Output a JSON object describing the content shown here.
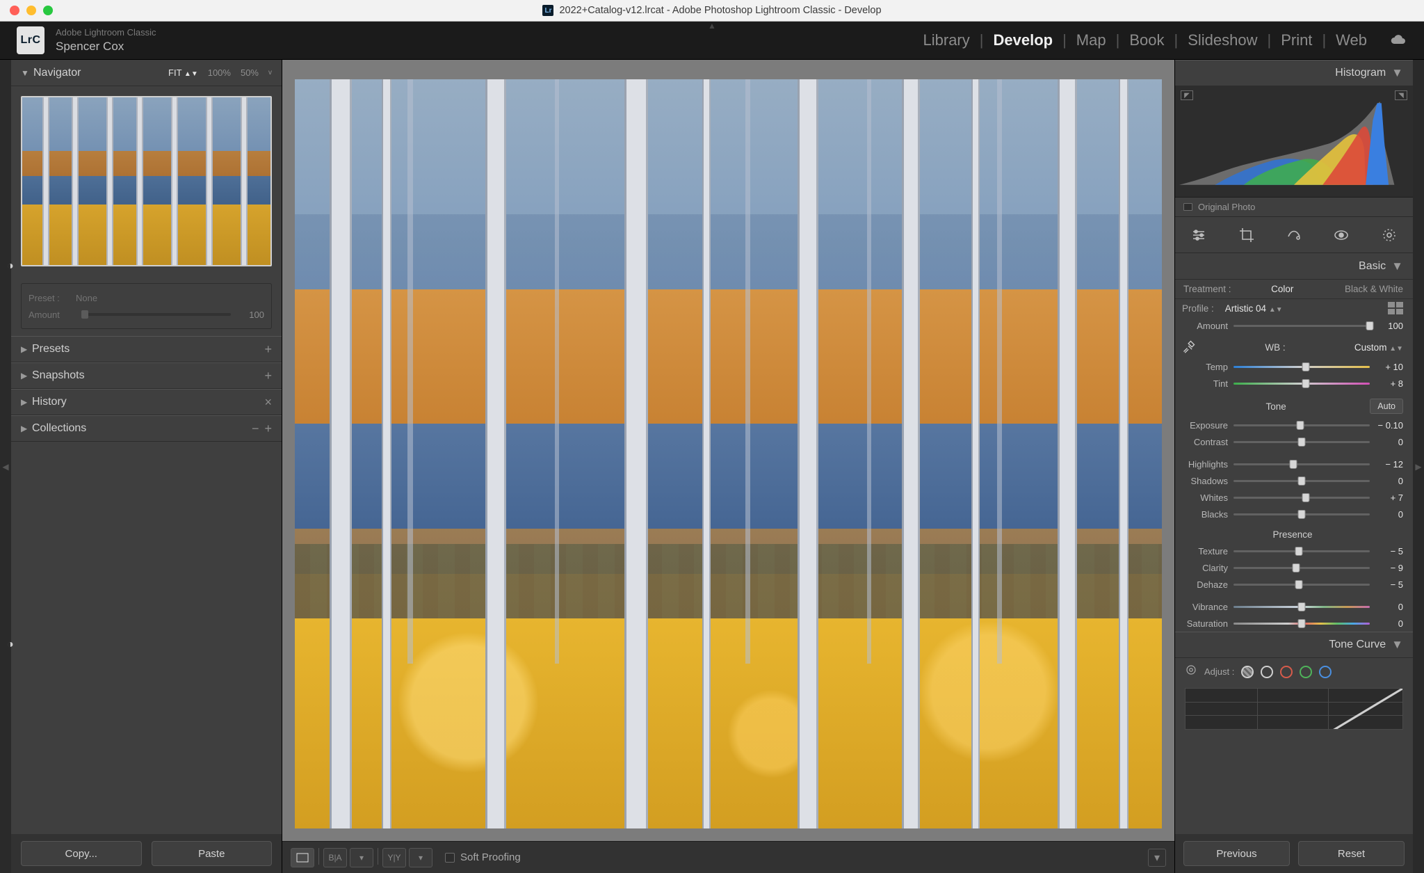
{
  "window": {
    "title": "2022+Catalog-v12.lrcat - Adobe Photoshop Lightroom Classic - Develop",
    "badge": "Lr"
  },
  "header": {
    "logo_text": "LrC",
    "app_name": "Adobe Lightroom Classic",
    "user_name": "Spencer Cox",
    "modules": [
      "Library",
      "Develop",
      "Map",
      "Book",
      "Slideshow",
      "Print",
      "Web"
    ],
    "active_module": "Develop"
  },
  "left": {
    "navigator": {
      "title": "Navigator",
      "zooms": [
        "FIT",
        "100%",
        "50%"
      ],
      "zoom_selected": "FIT",
      "zoom_chevron": "v"
    },
    "preset_box": {
      "preset_label": "Preset :",
      "preset_value": "None",
      "amount_label": "Amount",
      "amount_value": "100"
    },
    "sections": [
      {
        "title": "Presets",
        "icons": [
          "+"
        ]
      },
      {
        "title": "Snapshots",
        "icons": [
          "+"
        ]
      },
      {
        "title": "History",
        "icons": [
          "×"
        ]
      },
      {
        "title": "Collections",
        "icons": [
          "−",
          "+"
        ]
      }
    ],
    "buttons": {
      "copy": "Copy...",
      "paste": "Paste"
    }
  },
  "center": {
    "soft_proofing": "Soft Proofing"
  },
  "right": {
    "histogram_title": "Histogram",
    "original_photo": "Original Photo",
    "tools": [
      "edit-sliders-icon",
      "crop-icon",
      "healing-icon",
      "redeye-icon",
      "masking-icon"
    ],
    "basic": {
      "title": "Basic",
      "treatment_label": "Treatment :",
      "treatment_color": "Color",
      "treatment_bw": "Black & White",
      "profile_label": "Profile :",
      "profile_value": "Artistic 04",
      "amount_label": "Amount",
      "amount_value": "100",
      "wb_label": "WB :",
      "wb_value": "Custom",
      "tone_header": "Tone",
      "auto_label": "Auto",
      "presence_header": "Presence",
      "sliders": {
        "temp": {
          "label": "Temp",
          "value": "+ 10",
          "pos": 53
        },
        "tint": {
          "label": "Tint",
          "value": "+ 8",
          "pos": 53
        },
        "exposure": {
          "label": "Exposure",
          "value": "− 0.10",
          "pos": 49
        },
        "contrast": {
          "label": "Contrast",
          "value": "0",
          "pos": 50
        },
        "highlights": {
          "label": "Highlights",
          "value": "− 12",
          "pos": 44
        },
        "shadows": {
          "label": "Shadows",
          "value": "0",
          "pos": 50
        },
        "whites": {
          "label": "Whites",
          "value": "+ 7",
          "pos": 53
        },
        "blacks": {
          "label": "Blacks",
          "value": "0",
          "pos": 50
        },
        "texture": {
          "label": "Texture",
          "value": "− 5",
          "pos": 48
        },
        "clarity": {
          "label": "Clarity",
          "value": "− 9",
          "pos": 46
        },
        "dehaze": {
          "label": "Dehaze",
          "value": "− 5",
          "pos": 48
        },
        "vibrance": {
          "label": "Vibrance",
          "value": "0",
          "pos": 50
        },
        "saturation": {
          "label": "Saturation",
          "value": "0",
          "pos": 50
        }
      }
    },
    "tone_curve": {
      "title": "Tone Curve",
      "adjust_label": "Adjust :"
    },
    "buttons": {
      "previous": "Previous",
      "reset": "Reset"
    }
  }
}
